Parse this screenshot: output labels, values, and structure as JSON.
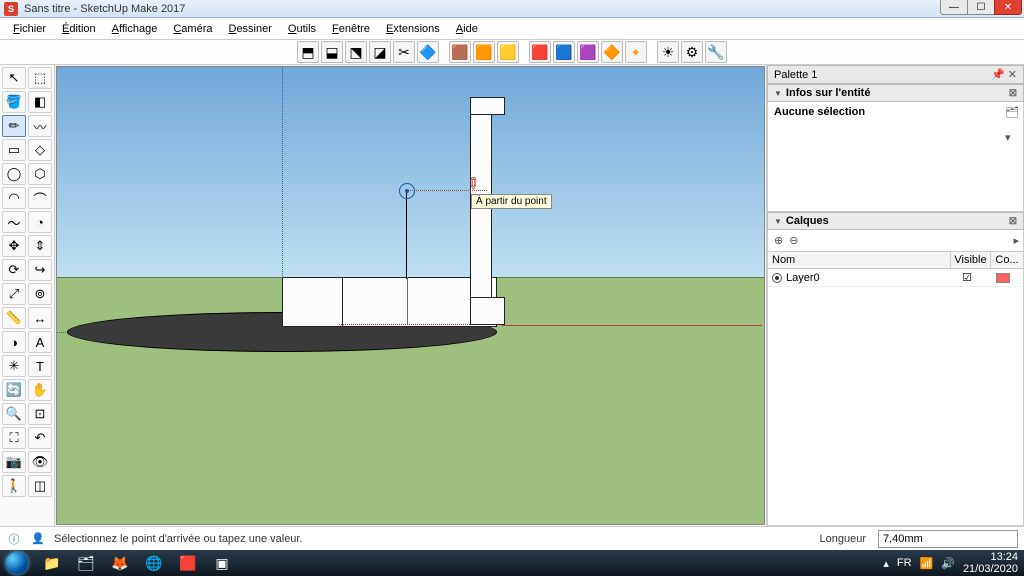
{
  "window": {
    "title": "Sans titre - SketchUp Make 2017",
    "app_icon_letter": "S"
  },
  "menu": {
    "items": [
      "Fichier",
      "Édition",
      "Affichage",
      "Caméra",
      "Dessiner",
      "Outils",
      "Fenêtre",
      "Extensions",
      "Aide"
    ]
  },
  "top_tools": {
    "group1": [
      "solid-union-icon",
      "solid-intersect-icon",
      "solid-subtract-icon",
      "solid-outer-shell-icon",
      "solid-trim-icon",
      "solid-split-icon"
    ],
    "group2": [
      "sandbox-contours-icon",
      "sandbox-scratch-icon",
      "sandbox-smoove-icon"
    ],
    "group3": [
      "sandbox-stamp-icon",
      "sandbox-drape-icon",
      "sandbox-detail-icon",
      "sandbox-flip-icon",
      "sandbox-project-icon"
    ],
    "group4": [
      "always-face-camera-icon",
      "styles-icon",
      "extensions-icon"
    ]
  },
  "left_tools": {
    "rows": [
      [
        "select-icon",
        "make-component-icon"
      ],
      [
        "paint-bucket-icon",
        "eraser-icon"
      ],
      [
        "line-icon",
        "freehand-icon"
      ],
      [
        "rectangle-icon",
        "rotated-rect-icon"
      ],
      [
        "circle-icon",
        "polygon-icon"
      ],
      [
        "arc-icon",
        "two-point-arc-icon"
      ],
      [
        "three-point-arc-icon",
        "pie-icon"
      ],
      [
        "move-icon",
        "push-pull-icon"
      ],
      [
        "rotate-icon",
        "follow-me-icon"
      ],
      [
        "scale-icon",
        "offset-icon"
      ],
      [
        "tape-measure-icon",
        "dimension-icon"
      ],
      [
        "protractor-icon",
        "text-label-icon"
      ],
      [
        "axes-icon",
        "three-d-text-icon"
      ],
      [
        "orbit-icon",
        "pan-icon"
      ],
      [
        "zoom-icon",
        "zoom-window-icon"
      ],
      [
        "zoom-extents-icon",
        "previous-view-icon"
      ],
      [
        "position-camera-icon",
        "look-around-icon"
      ],
      [
        "walk-icon",
        "section-plane-icon"
      ]
    ],
    "selected": "line-icon"
  },
  "viewport": {
    "tooltip": "À partir du point"
  },
  "right_panel": {
    "palette_title": "Palette 1",
    "entity_header": "Infos sur l'entité",
    "entity_body": "Aucune sélection",
    "layers_header": "Calques",
    "layers_col_name": "Nom",
    "layers_col_visible": "Visible",
    "layers_col_color": "Co...",
    "layers": [
      {
        "name": "Layer0",
        "visible": true,
        "color": "#ff6060",
        "active": true
      }
    ]
  },
  "status": {
    "hint": "Sélectionnez le point d'arrivée ou tapez une valeur.",
    "measure_label": "Longueur",
    "measure_value": "7,40mm"
  },
  "taskbar": {
    "icons": [
      "explorer-icon",
      "explorer-folder-icon",
      "firefox-icon",
      "firefox2-icon",
      "sketchup-icon",
      "app-icon"
    ],
    "tray_lang": "FR",
    "tray_time": "13:24",
    "tray_date": "21/03/2020"
  },
  "icon_glyphs": {
    "select-icon": "↖",
    "make-component-icon": "⬚",
    "paint-bucket-icon": "🪣",
    "eraser-icon": "◧",
    "line-icon": "✏",
    "freehand-icon": "〰",
    "rectangle-icon": "▭",
    "rotated-rect-icon": "◇",
    "circle-icon": "◯",
    "polygon-icon": "⬡",
    "arc-icon": "◠",
    "two-point-arc-icon": "⌒",
    "three-point-arc-icon": "〜",
    "pie-icon": "◔",
    "move-icon": "✥",
    "push-pull-icon": "⇕",
    "rotate-icon": "⟳",
    "follow-me-icon": "↪",
    "scale-icon": "⤢",
    "offset-icon": "⊚",
    "tape-measure-icon": "📏",
    "dimension-icon": "↔",
    "protractor-icon": "◑",
    "text-label-icon": "A",
    "axes-icon": "✳",
    "three-d-text-icon": "T",
    "orbit-icon": "🔄",
    "pan-icon": "✋",
    "zoom-icon": "🔍",
    "zoom-window-icon": "⊡",
    "zoom-extents-icon": "⛶",
    "previous-view-icon": "↶",
    "position-camera-icon": "📷",
    "look-around-icon": "👁",
    "walk-icon": "🚶",
    "section-plane-icon": "◫",
    "solid-union-icon": "⬒",
    "solid-intersect-icon": "⬓",
    "solid-subtract-icon": "⬔",
    "solid-outer-shell-icon": "◪",
    "solid-trim-icon": "✂",
    "solid-split-icon": "🔷",
    "sandbox-contours-icon": "🟫",
    "sandbox-scratch-icon": "🟧",
    "sandbox-smoove-icon": "🟨",
    "sandbox-stamp-icon": "🟥",
    "sandbox-drape-icon": "🟦",
    "sandbox-detail-icon": "🟪",
    "sandbox-flip-icon": "🔶",
    "sandbox-project-icon": "🔸",
    "always-face-camera-icon": "☀",
    "styles-icon": "⚙",
    "extensions-icon": "🔧",
    "explorer-icon": "📁",
    "explorer-folder-icon": "🗂",
    "firefox-icon": "🦊",
    "firefox2-icon": "🌐",
    "sketchup-icon": "🟥",
    "app-icon": "▣"
  }
}
